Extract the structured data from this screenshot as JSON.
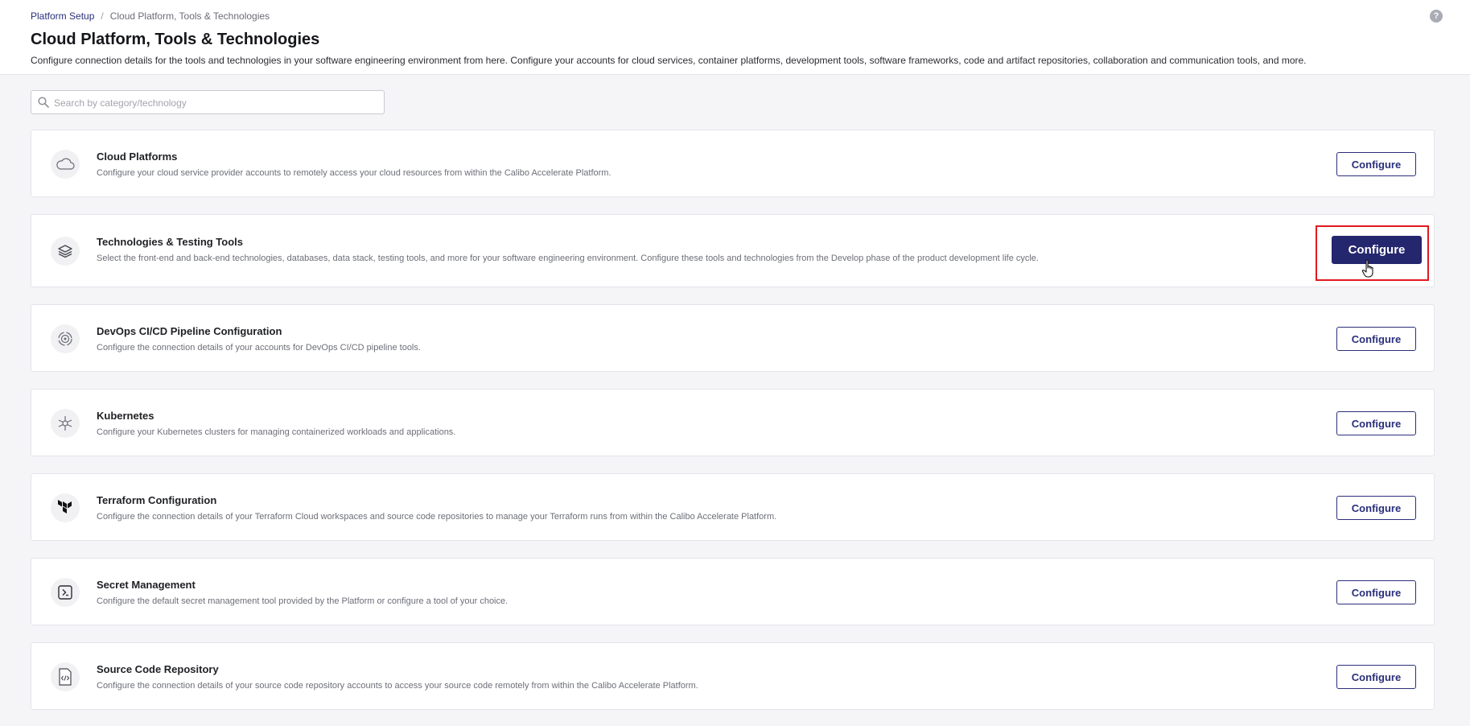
{
  "breadcrumb": {
    "parent": "Platform Setup",
    "separator": "/",
    "current": "Cloud Platform, Tools & Technologies"
  },
  "header": {
    "title": "Cloud Platform, Tools & Technologies",
    "description": "Configure connection details for the tools and technologies in your software engineering environment from here. Configure your accounts for cloud services, container platforms, development tools, software frameworks, code and artifact repositories, collaboration and communication tools, and more.",
    "help": "?"
  },
  "search": {
    "placeholder": "Search by category/technology",
    "value": ""
  },
  "cards": [
    {
      "icon": "cloud-icon",
      "title": "Cloud Platforms",
      "description": "Configure your cloud service provider accounts to remotely access your cloud resources from within the Calibo Accelerate Platform.",
      "button": "Configure"
    },
    {
      "icon": "layers-icon",
      "title": "Technologies & Testing Tools",
      "description": "Select the front-end and back-end technologies, databases, data stack, testing tools, and more for your software engineering environment. Configure these tools and technologies from the Develop phase of the product development life cycle.",
      "button": "Configure"
    },
    {
      "icon": "pipeline-icon",
      "title": "DevOps CI/CD Pipeline Configuration",
      "description": "Configure the connection details of your accounts for DevOps CI/CD pipeline tools.",
      "button": "Configure"
    },
    {
      "icon": "kubernetes-icon",
      "title": "Kubernetes",
      "description": "Configure your Kubernetes clusters for managing containerized workloads and applications.",
      "button": "Configure"
    },
    {
      "icon": "terraform-icon",
      "title": "Terraform Configuration",
      "description": "Configure the connection details of your Terraform Cloud workspaces and source code repositories to manage your Terraform runs from within the Calibo Accelerate Platform.",
      "button": "Configure"
    },
    {
      "icon": "secret-icon",
      "title": "Secret Management",
      "description": "Configure the default secret management tool provided by the Platform or configure a tool of your choice.",
      "button": "Configure"
    },
    {
      "icon": "code-file-icon",
      "title": "Source Code Repository",
      "description": "Configure the connection details of your source code repository accounts to access your source code remotely from within the Calibo Accelerate Platform.",
      "button": "Configure"
    }
  ],
  "colors": {
    "accent": "#24266e",
    "highlight": "#e0191f",
    "background": "#f5f5f7"
  }
}
